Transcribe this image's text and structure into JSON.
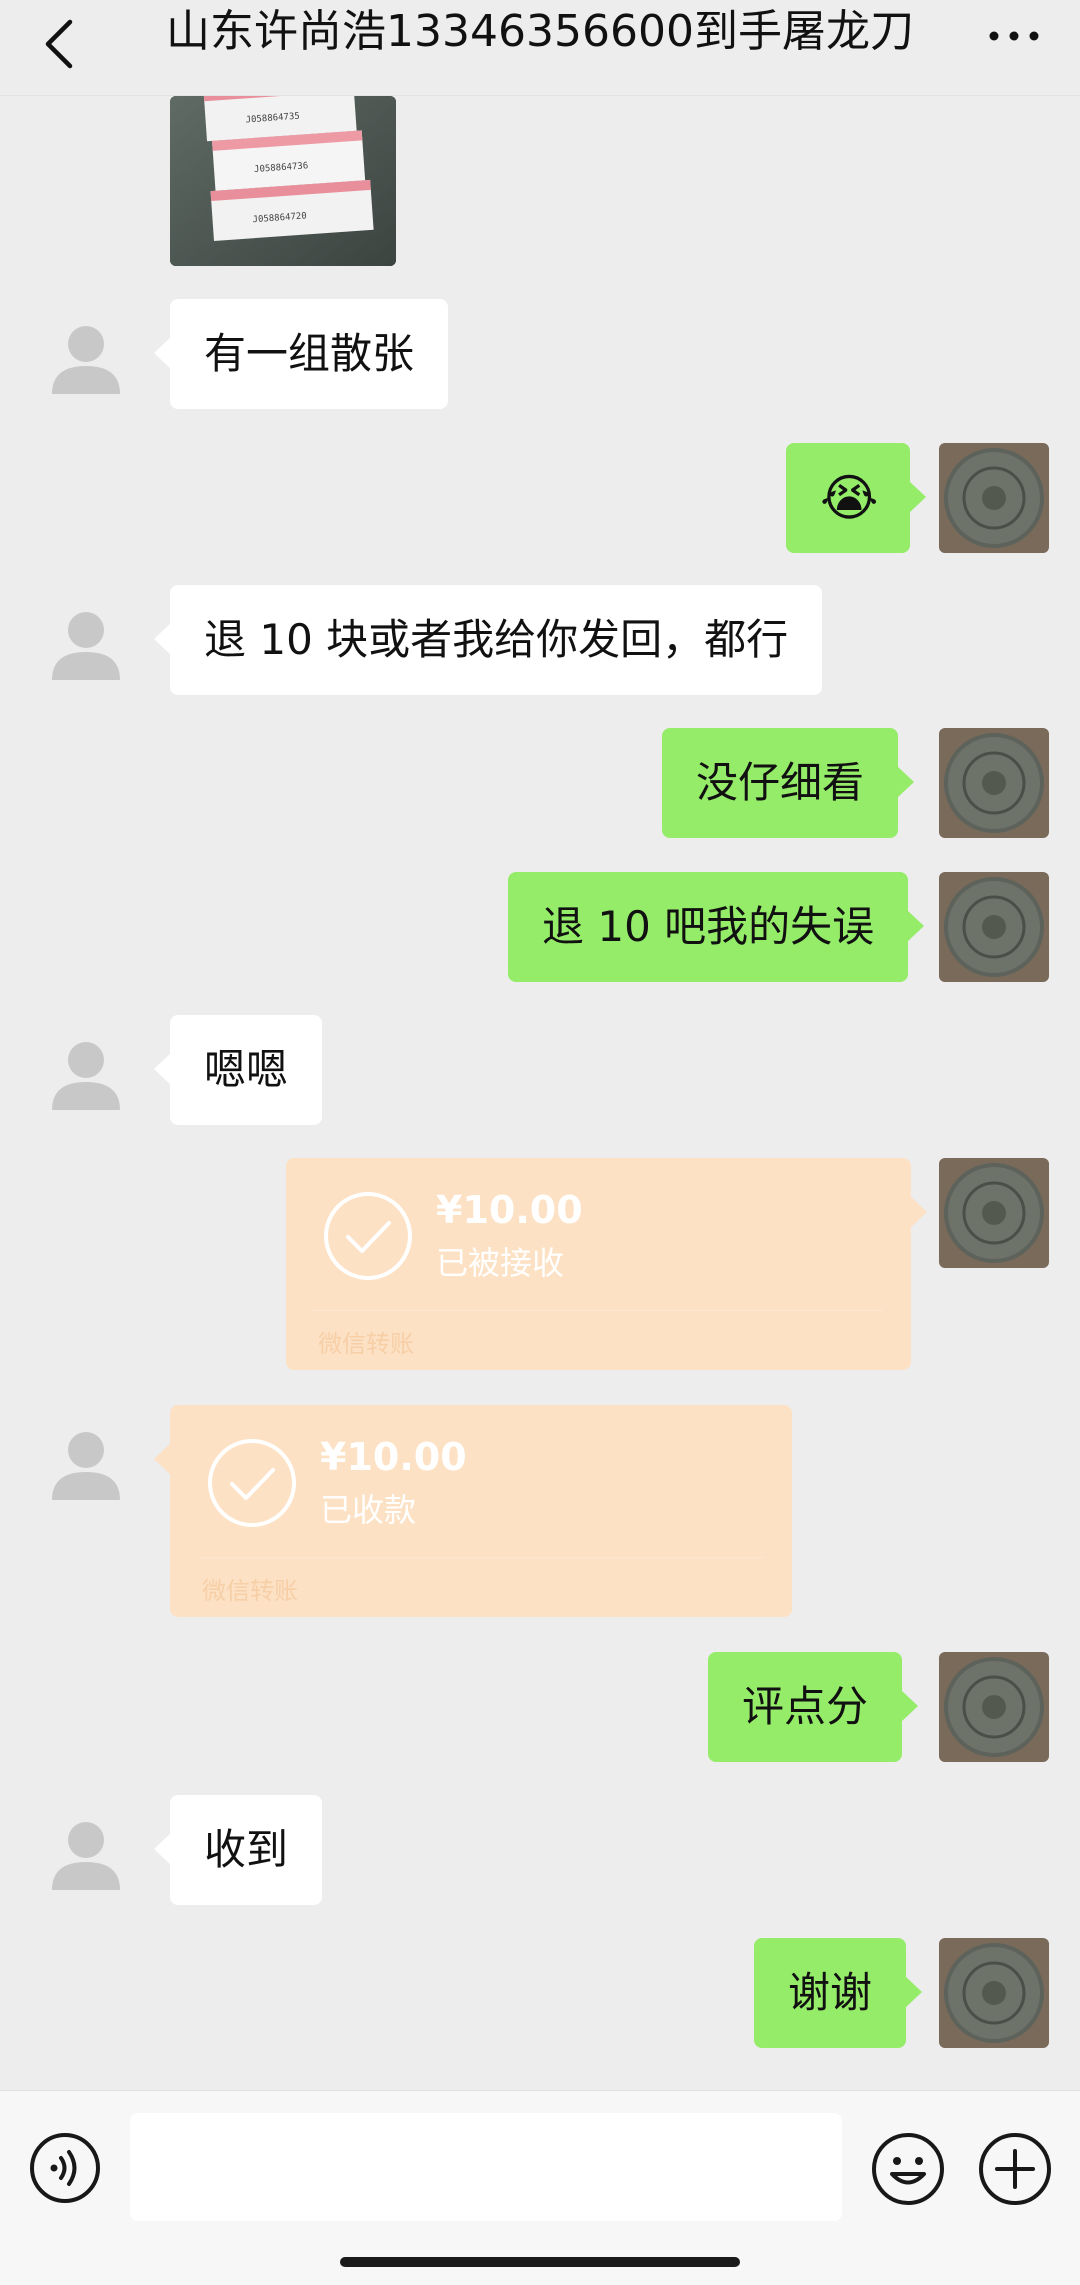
{
  "header": {
    "title": "山东许尚浩13346356600到手屠龙刀",
    "back_icon": "chevron-left-icon",
    "more_icon": "more-dots-icon"
  },
  "photo": {
    "labels": [
      "J058864735",
      "J058864736",
      "J058864720"
    ]
  },
  "messages": [
    {
      "side": "left",
      "text": "有一组散张"
    },
    {
      "side": "right",
      "text": "😭"
    },
    {
      "side": "left",
      "text": "退 10 块或者我给你发回，都行"
    },
    {
      "side": "right",
      "text": "没仔细看"
    },
    {
      "side": "right",
      "text": "退 10 吧我的失误"
    },
    {
      "side": "left",
      "text": "嗯嗯"
    },
    {
      "side": "right",
      "type": "transfer",
      "amount": "¥10.00",
      "status": "已被接收",
      "label": "微信转账"
    },
    {
      "side": "left",
      "type": "transfer",
      "amount": "¥10.00",
      "status": "已收款",
      "label": "微信转账"
    },
    {
      "side": "right",
      "text": "评点分"
    },
    {
      "side": "left",
      "text": "收到"
    },
    {
      "side": "right",
      "text": "谢谢"
    }
  ],
  "input_bar": {
    "voice_icon": "voice-icon",
    "text_value": "",
    "emoji_icon": "emoji-icon",
    "plus_icon": "plus-icon"
  },
  "colors": {
    "background": "#ededed",
    "bubble_self": "#95ec69",
    "bubble_other": "#ffffff",
    "transfer_card": "#fde1c4"
  }
}
